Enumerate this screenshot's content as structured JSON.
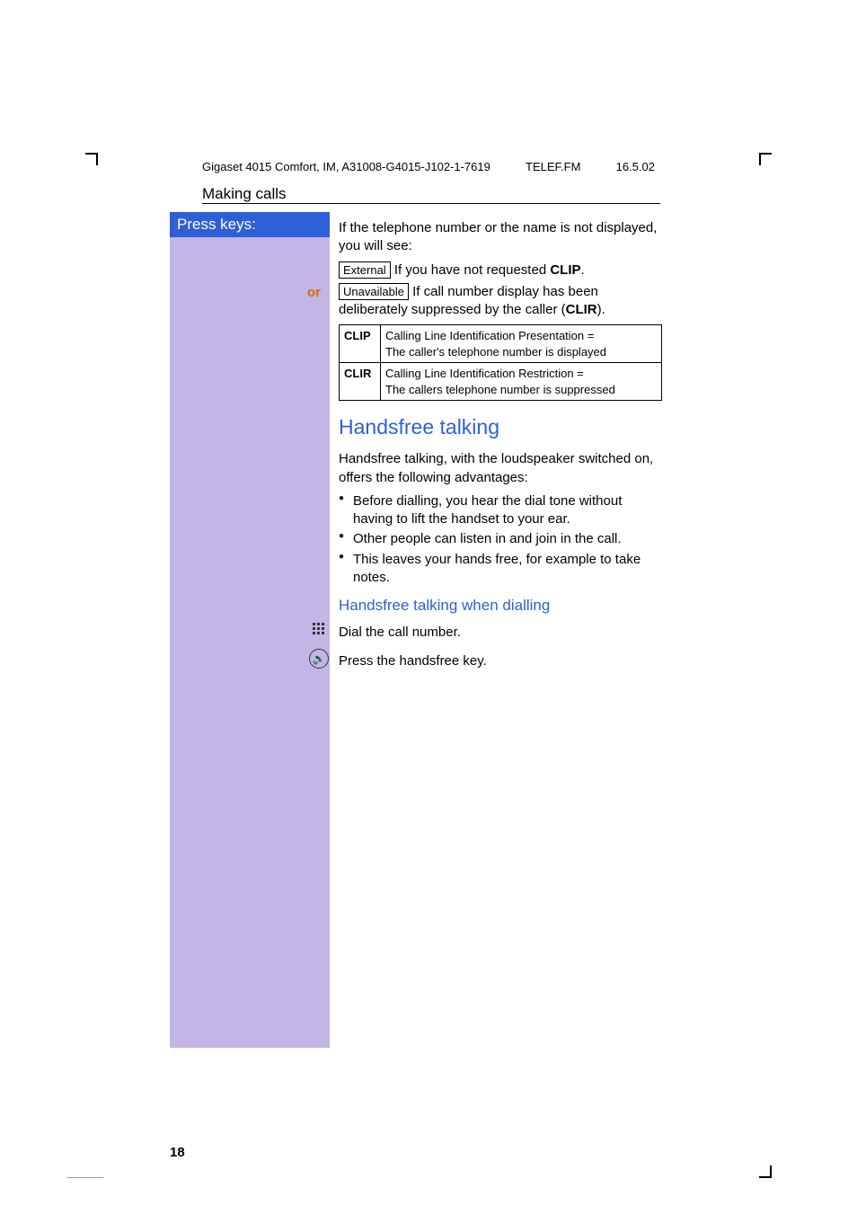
{
  "header": {
    "left": "Gigaset 4015 Comfort, IM, A31008-G4015-J102-1-7619",
    "mid": "TELEF.FM",
    "right": "16.5.02"
  },
  "section": "Making calls",
  "sidebar": {
    "title": "Press keys:"
  },
  "or": "or",
  "body": {
    "intro": "If the telephone number or the name is not displayed, you will see:",
    "ext_box": "External",
    "ext_text_pre": "If you have not requested ",
    "ext_text_bold": "CLIP",
    "ext_text_post": ".",
    "una_box": "Unavailable",
    "una_text_pre": "If call number display has been deliberately suppressed by the caller (",
    "una_text_bold": "CLIR",
    "una_text_post": ").",
    "clip_label": "CLIP",
    "clip_desc1": "Calling Line Identification Presentation =",
    "clip_desc2": "The caller's telephone number is displayed",
    "clir_label": "CLIR",
    "clir_desc1": "Calling Line Identification Restriction =",
    "clir_desc2": "The callers telephone number is suppressed",
    "hf_title": "Handsfree talking",
    "hf_intro": "Handsfree talking, with the loudspeaker switched on, offers the following advantages:",
    "bul1": "Before dialling, you hear the dial tone without having to lift the handset to your ear.",
    "bul2": "Other people can listen in and join in the call.",
    "bul3": "This leaves your hands free, for example to take notes.",
    "hf_sub": "Handsfree talking when dialling",
    "step1": "Dial the call number.",
    "step2": "Press the handsfree key."
  },
  "page": "18"
}
